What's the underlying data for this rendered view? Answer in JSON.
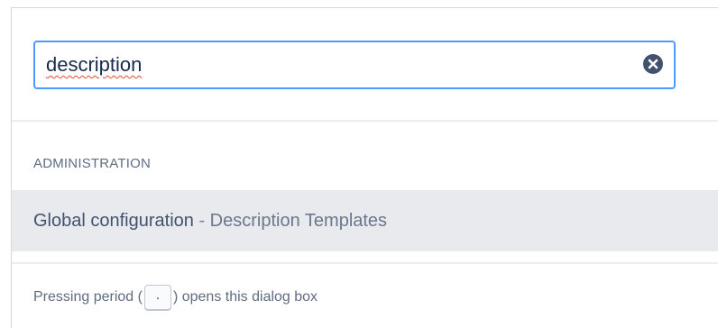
{
  "search": {
    "value": "description",
    "placeholder": ""
  },
  "icons": {
    "clear": "clear-icon"
  },
  "colors": {
    "focus_border": "#4c9aff",
    "highlight_row": "#e8eaee",
    "spellcheck": "#e34935"
  },
  "results": {
    "section_heading": "ADMINISTRATION",
    "items": [
      {
        "primary": "Global configuration",
        "separator": " - ",
        "secondary": "Description Templates"
      }
    ]
  },
  "footer": {
    "before": "Pressing period (",
    "key": ".",
    "after": ") opens this dialog box"
  }
}
